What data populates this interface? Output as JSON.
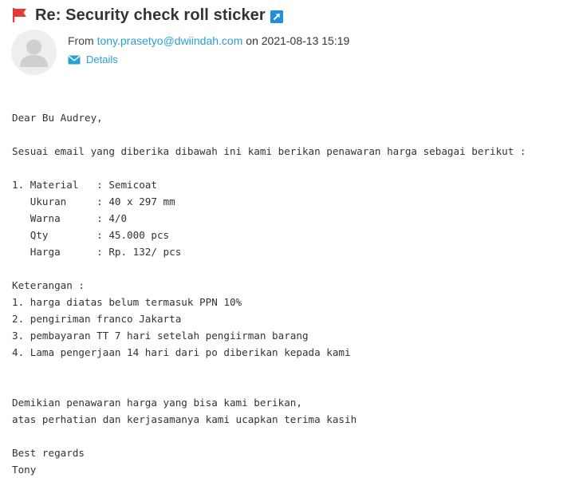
{
  "message": {
    "subject": "Re: Security check roll sticker",
    "from_label": "From",
    "from_email": "tony.prasetyo@dwiindah.com",
    "date_prefix": "on",
    "date": "2021-08-13 15:19",
    "details_label": "Details"
  },
  "body": {
    "lines": [
      "Dear Bu Audrey,",
      "",
      "Sesuai email yang diberika dibawah ini kami berikan penawaran harga sebagai berikut :",
      "",
      "1. Material   : Semicoat",
      "   Ukuran     : 40 x 297 mm",
      "   Warna      : 4/0",
      "   Qty        : 45.000 pcs",
      "   Harga      : Rp. 132/ pcs",
      "",
      "Keterangan :",
      "1. harga diatas belum termasuk PPN 10%",
      "2. pengiriman franco Jakarta",
      "3. pembayaran TT 7 hari setelah pengiirman barang",
      "4. Lama pengerjaan 14 hari dari po diberikan kepada kami",
      "",
      "",
      "Demikian penawaran harga yang bisa kami berikan,",
      "atas perhatian dan kerjasamanya kami ucapkan terima kasih",
      "",
      "Best regards",
      "Tony"
    ]
  },
  "colors": {
    "flag": "#e53935",
    "link": "#2a9fd6",
    "open_icon_bg": "#1e90e0"
  },
  "icons": {
    "flag": "flag-icon",
    "open_external": "open-external-icon",
    "avatar": "avatar",
    "details": "envelope-icon"
  }
}
